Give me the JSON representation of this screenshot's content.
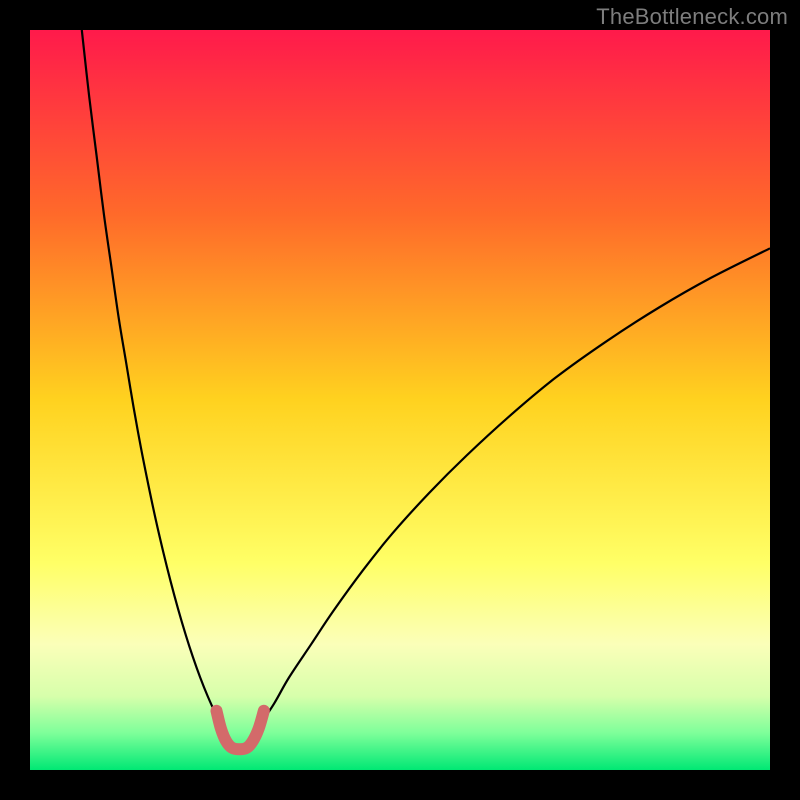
{
  "watermark": "TheBottleneck.com",
  "chart_data": {
    "type": "line",
    "title": "",
    "xlabel": "",
    "ylabel": "",
    "xlim": [
      0,
      100
    ],
    "ylim": [
      0,
      100
    ],
    "grid": false,
    "legend": false,
    "background_gradient": {
      "stops": [
        {
          "offset": 0.0,
          "color": "#ff1a4b"
        },
        {
          "offset": 0.25,
          "color": "#ff6a2a"
        },
        {
          "offset": 0.5,
          "color": "#ffd21f"
        },
        {
          "offset": 0.72,
          "color": "#ffff66"
        },
        {
          "offset": 0.83,
          "color": "#fbffb9"
        },
        {
          "offset": 0.9,
          "color": "#d7ffab"
        },
        {
          "offset": 0.95,
          "color": "#7eff9a"
        },
        {
          "offset": 1.0,
          "color": "#00e874"
        }
      ]
    },
    "series": [
      {
        "name": "left-branch",
        "color": "#000000",
        "width": 2.2,
        "x": [
          7,
          8,
          9,
          10,
          11,
          12,
          13,
          14,
          15,
          16,
          17,
          18,
          19,
          20,
          21,
          22,
          23,
          24,
          25,
          26
        ],
        "y": [
          100,
          91,
          83,
          75,
          68,
          61,
          55,
          49,
          43.5,
          38.5,
          33.8,
          29.5,
          25.5,
          21.8,
          18.4,
          15.3,
          12.5,
          10,
          7.8,
          6
        ]
      },
      {
        "name": "right-branch",
        "color": "#000000",
        "width": 2.2,
        "x": [
          31,
          33,
          35,
          38,
          41,
          45,
          49,
          54,
          59,
          65,
          71,
          78,
          85,
          92,
          100
        ],
        "y": [
          6,
          9,
          12.5,
          17,
          21.5,
          27,
          32,
          37.5,
          42.5,
          48,
          53,
          58,
          62.5,
          66.5,
          70.5
        ]
      },
      {
        "name": "valley-highlight",
        "color": "#d36a6a",
        "width": 12,
        "linecap": "round",
        "x": [
          25.2,
          25.8,
          26.5,
          27.3,
          28.3,
          29.3,
          30.1,
          30.9,
          31.6
        ],
        "y": [
          8.0,
          5.6,
          3.9,
          3.0,
          2.8,
          3.0,
          3.9,
          5.6,
          8.0
        ]
      }
    ]
  }
}
